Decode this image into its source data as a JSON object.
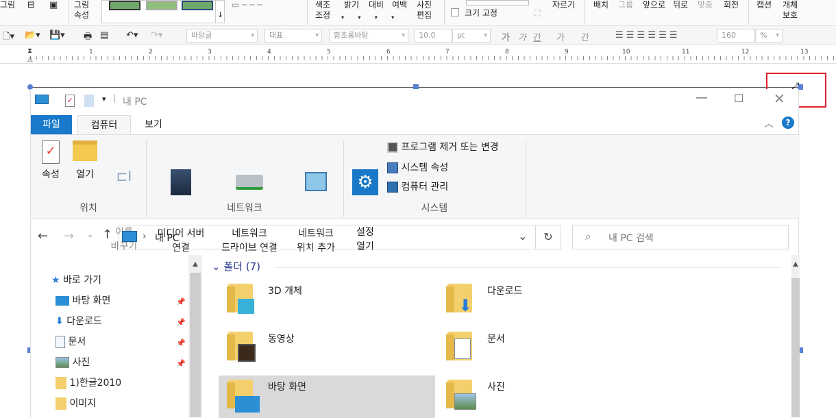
{
  "hwp_ribbon": {
    "left_labels": [
      "그림",
      "그림\n속성"
    ],
    "color_adjust": "색조\n조정",
    "brightness": "밝기",
    "contrast": "대비",
    "margin": "여백",
    "photo_edit": "사진\n편집",
    "size_fixed": "크기 고정",
    "crop": "자르기",
    "arrange": "배치",
    "group": "그룹",
    "front": "앞으로",
    "back": "뒤로",
    "align": "맞춤",
    "rotate": "회전",
    "caption": "캡션",
    "protect": "개체\n보호"
  },
  "hwp_toolbar": {
    "style_combo": "바탕글",
    "outline_combo": "대표",
    "font_combo": "함초롬바탕",
    "size_value": "10.0",
    "size_unit": "pt",
    "char_buttons": [
      "가",
      "가",
      "간",
      "가",
      "간"
    ],
    "zoom_value": "160",
    "zoom_unit": "%"
  },
  "ruler_numbers": [
    "1",
    "2",
    "3",
    "4",
    "5",
    "6",
    "7",
    "8",
    "9",
    "10",
    "11",
    "12",
    "13"
  ],
  "explorer": {
    "title": "내 PC",
    "tabs": [
      "파일",
      "컴퓨터",
      "보기"
    ],
    "ribbon": {
      "properties": "속성",
      "open": "열기",
      "rename": "이름\n바꾸기",
      "media_server": "미디어 서버\n연결",
      "map_drive": "네트워크\n드라이브 연결",
      "add_location": "네트워크\n위치 추가",
      "settings": "설정\n열기",
      "uninstall": "프로그램 제거 또는 변경",
      "system_props": "시스템 속성",
      "manage": "컴퓨터 관리",
      "group_location": "위치",
      "group_network": "네트워크",
      "group_system": "시스템"
    },
    "address": "내 PC",
    "search_placeholder": "내 PC 검색",
    "nav": [
      {
        "label": "바로 가기",
        "icon": "star-icon"
      },
      {
        "label": "바탕 화면",
        "icon": "desktop-icon",
        "pinned": true
      },
      {
        "label": "다운로드",
        "icon": "download-icon",
        "pinned": true
      },
      {
        "label": "문서",
        "icon": "document-icon",
        "pinned": true
      },
      {
        "label": "사진",
        "icon": "picture-icon",
        "pinned": true
      },
      {
        "label": "1)한글2010",
        "icon": "folder-icon"
      },
      {
        "label": "이미지",
        "icon": "folder-icon"
      }
    ],
    "section_title": "폴더 (7)",
    "folders": [
      "3D 개체",
      "다운로드",
      "동영상",
      "문서",
      "바탕 화면",
      "사진"
    ],
    "colors": {
      "accent": "#1979ca",
      "selected": "#cce8ff",
      "hover": "#d9d9d9",
      "highlight_box": "#e0242c"
    }
  }
}
